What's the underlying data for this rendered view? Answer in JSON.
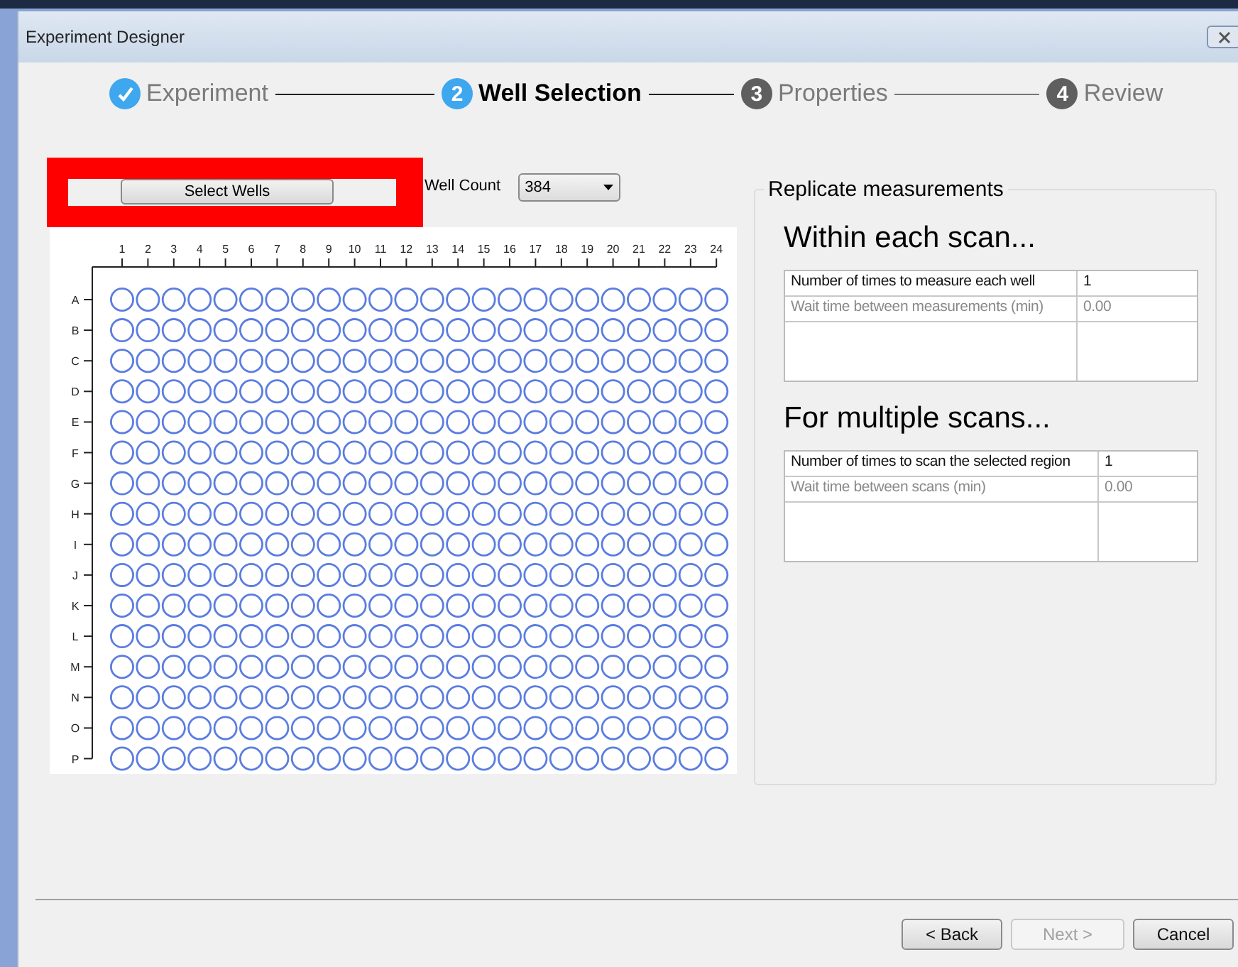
{
  "window": {
    "title": "Experiment Designer"
  },
  "steps": [
    {
      "label": "Experiment",
      "completed": true,
      "selected": false
    },
    {
      "number": "2",
      "label": "Well Selection",
      "completed": false,
      "selected": true
    },
    {
      "number": "3",
      "label": "Properties",
      "completed": false,
      "selected": false
    },
    {
      "number": "4",
      "label": "Review",
      "completed": false,
      "selected": false
    }
  ],
  "select_button": "Select Wells",
  "well_count": {
    "label": "Well Count",
    "value": "384"
  },
  "plate": {
    "columns": [
      "1",
      "2",
      "3",
      "4",
      "5",
      "6",
      "7",
      "8",
      "9",
      "10",
      "11",
      "12",
      "13",
      "14",
      "15",
      "16",
      "17",
      "18",
      "19",
      "20",
      "21",
      "22",
      "23",
      "24"
    ],
    "rows": [
      "A",
      "B",
      "C",
      "D",
      "E",
      "F",
      "G",
      "H",
      "I",
      "J",
      "K",
      "L",
      "M",
      "N",
      "O",
      "P"
    ]
  },
  "replicate": {
    "title": "Replicate measurements",
    "sections": [
      {
        "heading": "Within each scan...",
        "rows": [
          {
            "label": "Number of times to measure each well",
            "value": "1",
            "disabled": false
          },
          {
            "label": "Wait time between measurements (min)",
            "value": "0.00",
            "disabled": true
          }
        ]
      },
      {
        "heading": "For multiple scans...",
        "rows": [
          {
            "label": "Number of times to scan the selected region",
            "value": "1",
            "disabled": false
          },
          {
            "label": "Wait time between scans (min)",
            "value": "0.00",
            "disabled": true
          }
        ]
      }
    ]
  },
  "buttons": [
    {
      "label": "< Back",
      "disabled": false
    },
    {
      "label": "Next >",
      "disabled": true
    },
    {
      "label": "Cancel",
      "disabled": false
    }
  ]
}
